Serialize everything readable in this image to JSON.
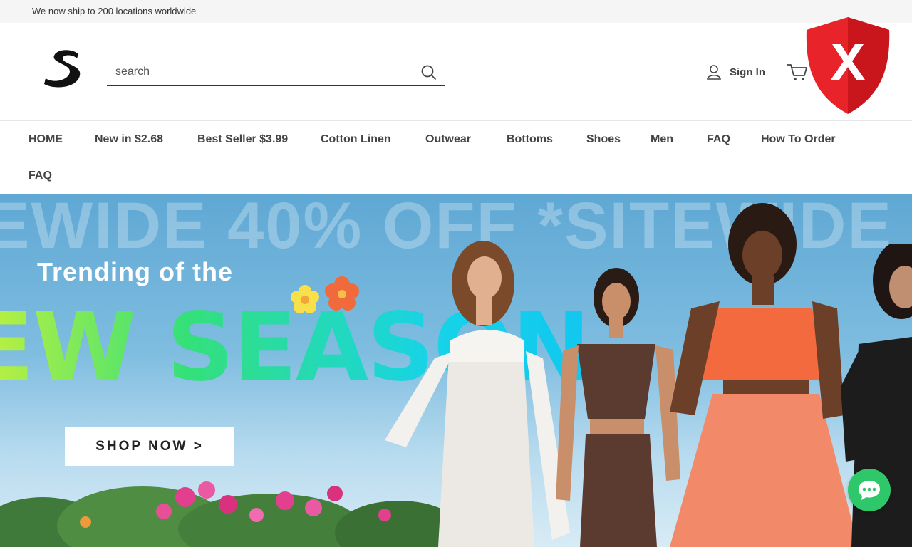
{
  "announcement": "We now ship to 200 locations worldwide",
  "search": {
    "placeholder": "search"
  },
  "account": {
    "signin_label": "Sign In"
  },
  "nav": {
    "items": [
      {
        "label": "HOME"
      },
      {
        "label": "New in $2.68"
      },
      {
        "label": "Best Seller $3.99"
      },
      {
        "label": "Cotton Linen"
      },
      {
        "label": "Outwear"
      },
      {
        "label": "Bottoms"
      },
      {
        "label": "Shoes"
      },
      {
        "label": "Men"
      },
      {
        "label": "FAQ"
      },
      {
        "label": "How To Order"
      },
      {
        "label": "FAQ"
      }
    ]
  },
  "hero": {
    "bg_text": "EWIDE 40% OFF *SITEWIDE",
    "subtitle": "Trending of the",
    "title": "EW SEASON",
    "cta": "SHOP NOW >"
  },
  "icons": {
    "logo": "brand-s-logo",
    "search": "search-icon",
    "user": "user-icon",
    "cart": "cart-icon",
    "shield": "red-shield-x-icon",
    "chat": "chat-bubble-icon"
  },
  "colors": {
    "announcement_bg": "#f5f5f5",
    "shield_red": "#e8232a",
    "chat_green": "#2ec76a",
    "title_gradient_start": "#c8f23a",
    "title_gradient_end": "#11c7f0"
  }
}
